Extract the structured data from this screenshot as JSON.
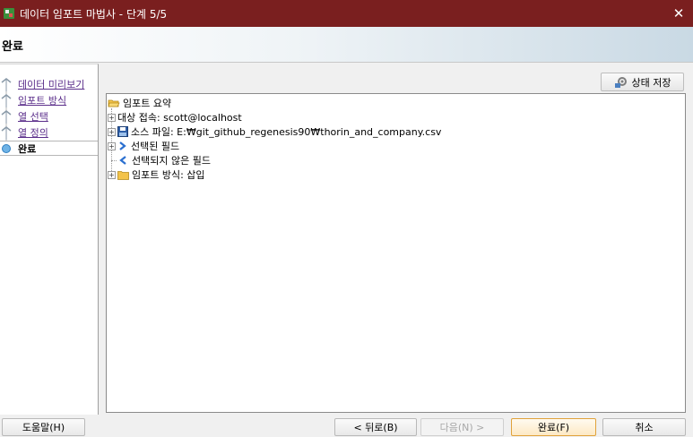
{
  "window": {
    "title": "데이터 임포트 마법사 - 단계 5/5",
    "close_glyph": "✕",
    "app_icon": "sql-developer-icon"
  },
  "header": {
    "title": "완료"
  },
  "steps": [
    {
      "label": "데이터 미리보기",
      "state": "done"
    },
    {
      "label": "임포트 방식",
      "state": "done"
    },
    {
      "label": "열 선택",
      "state": "done"
    },
    {
      "label": "열 정의",
      "state": "done"
    },
    {
      "label": "완료",
      "state": "current"
    }
  ],
  "toolbar": {
    "save_state_label": "상태 저장",
    "save_state_icon": "gear-save-icon"
  },
  "summary_tree": {
    "root": "임포트 요약",
    "items": [
      {
        "label": "대상 접속: scott@localhost",
        "icon": "none",
        "expandable": true
      },
      {
        "label": "소스 파일: E:₩git_github_regenesis90₩thorin_and_company.csv",
        "icon": "disk-icon",
        "expandable": true
      },
      {
        "label": "선택된 필드",
        "icon": "arrow-right-icon",
        "expandable": true
      },
      {
        "label": "선택되지 않은 필드",
        "icon": "arrow-left-icon",
        "expandable": false
      },
      {
        "label": "임포트 방식: 삽입",
        "icon": "folder-icon",
        "expandable": true
      }
    ]
  },
  "buttons": {
    "help": "도움말(H)",
    "back": "< 뒤로(B)",
    "next": "다음(N) >",
    "finish": "완료(F)",
    "cancel": "취소"
  },
  "colors": {
    "titlebar": "#7a1f1f",
    "link": "#5a2d8a",
    "primary_border": "#e0a23a"
  }
}
